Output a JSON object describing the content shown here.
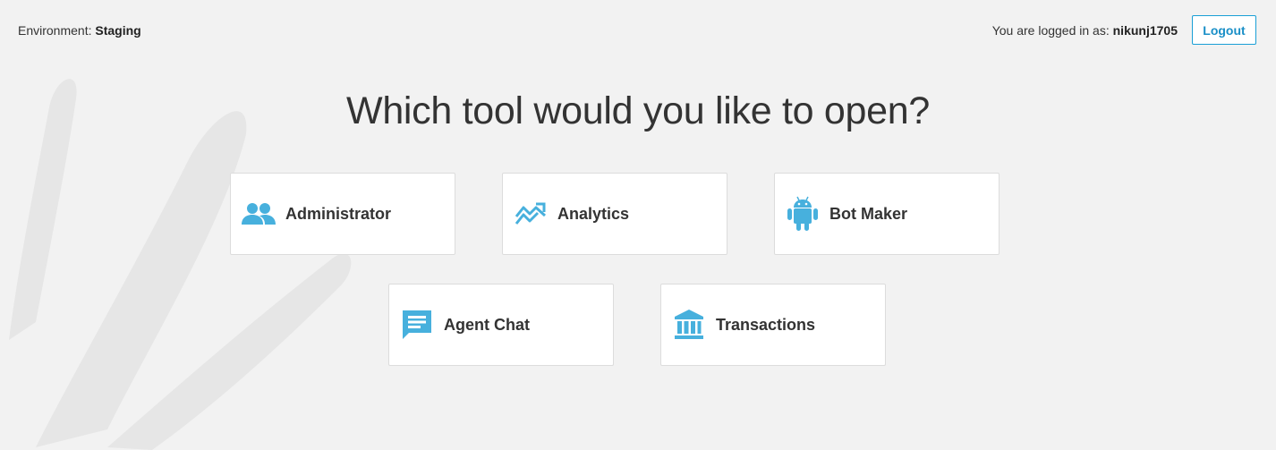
{
  "environment": {
    "label": "Environment:",
    "value": "Staging"
  },
  "user": {
    "label": "You are logged in as:",
    "username": "nikunj1705"
  },
  "logout_label": "Logout",
  "heading": "Which tool would you like to open?",
  "accent_color": "#47b0dd",
  "tools": [
    {
      "label": "Administrator",
      "icon": "people-icon"
    },
    {
      "label": "Analytics",
      "icon": "trending-icon"
    },
    {
      "label": "Bot Maker",
      "icon": "android-icon"
    },
    {
      "label": "Agent Chat",
      "icon": "chat-icon"
    },
    {
      "label": "Transactions",
      "icon": "bank-icon"
    }
  ]
}
